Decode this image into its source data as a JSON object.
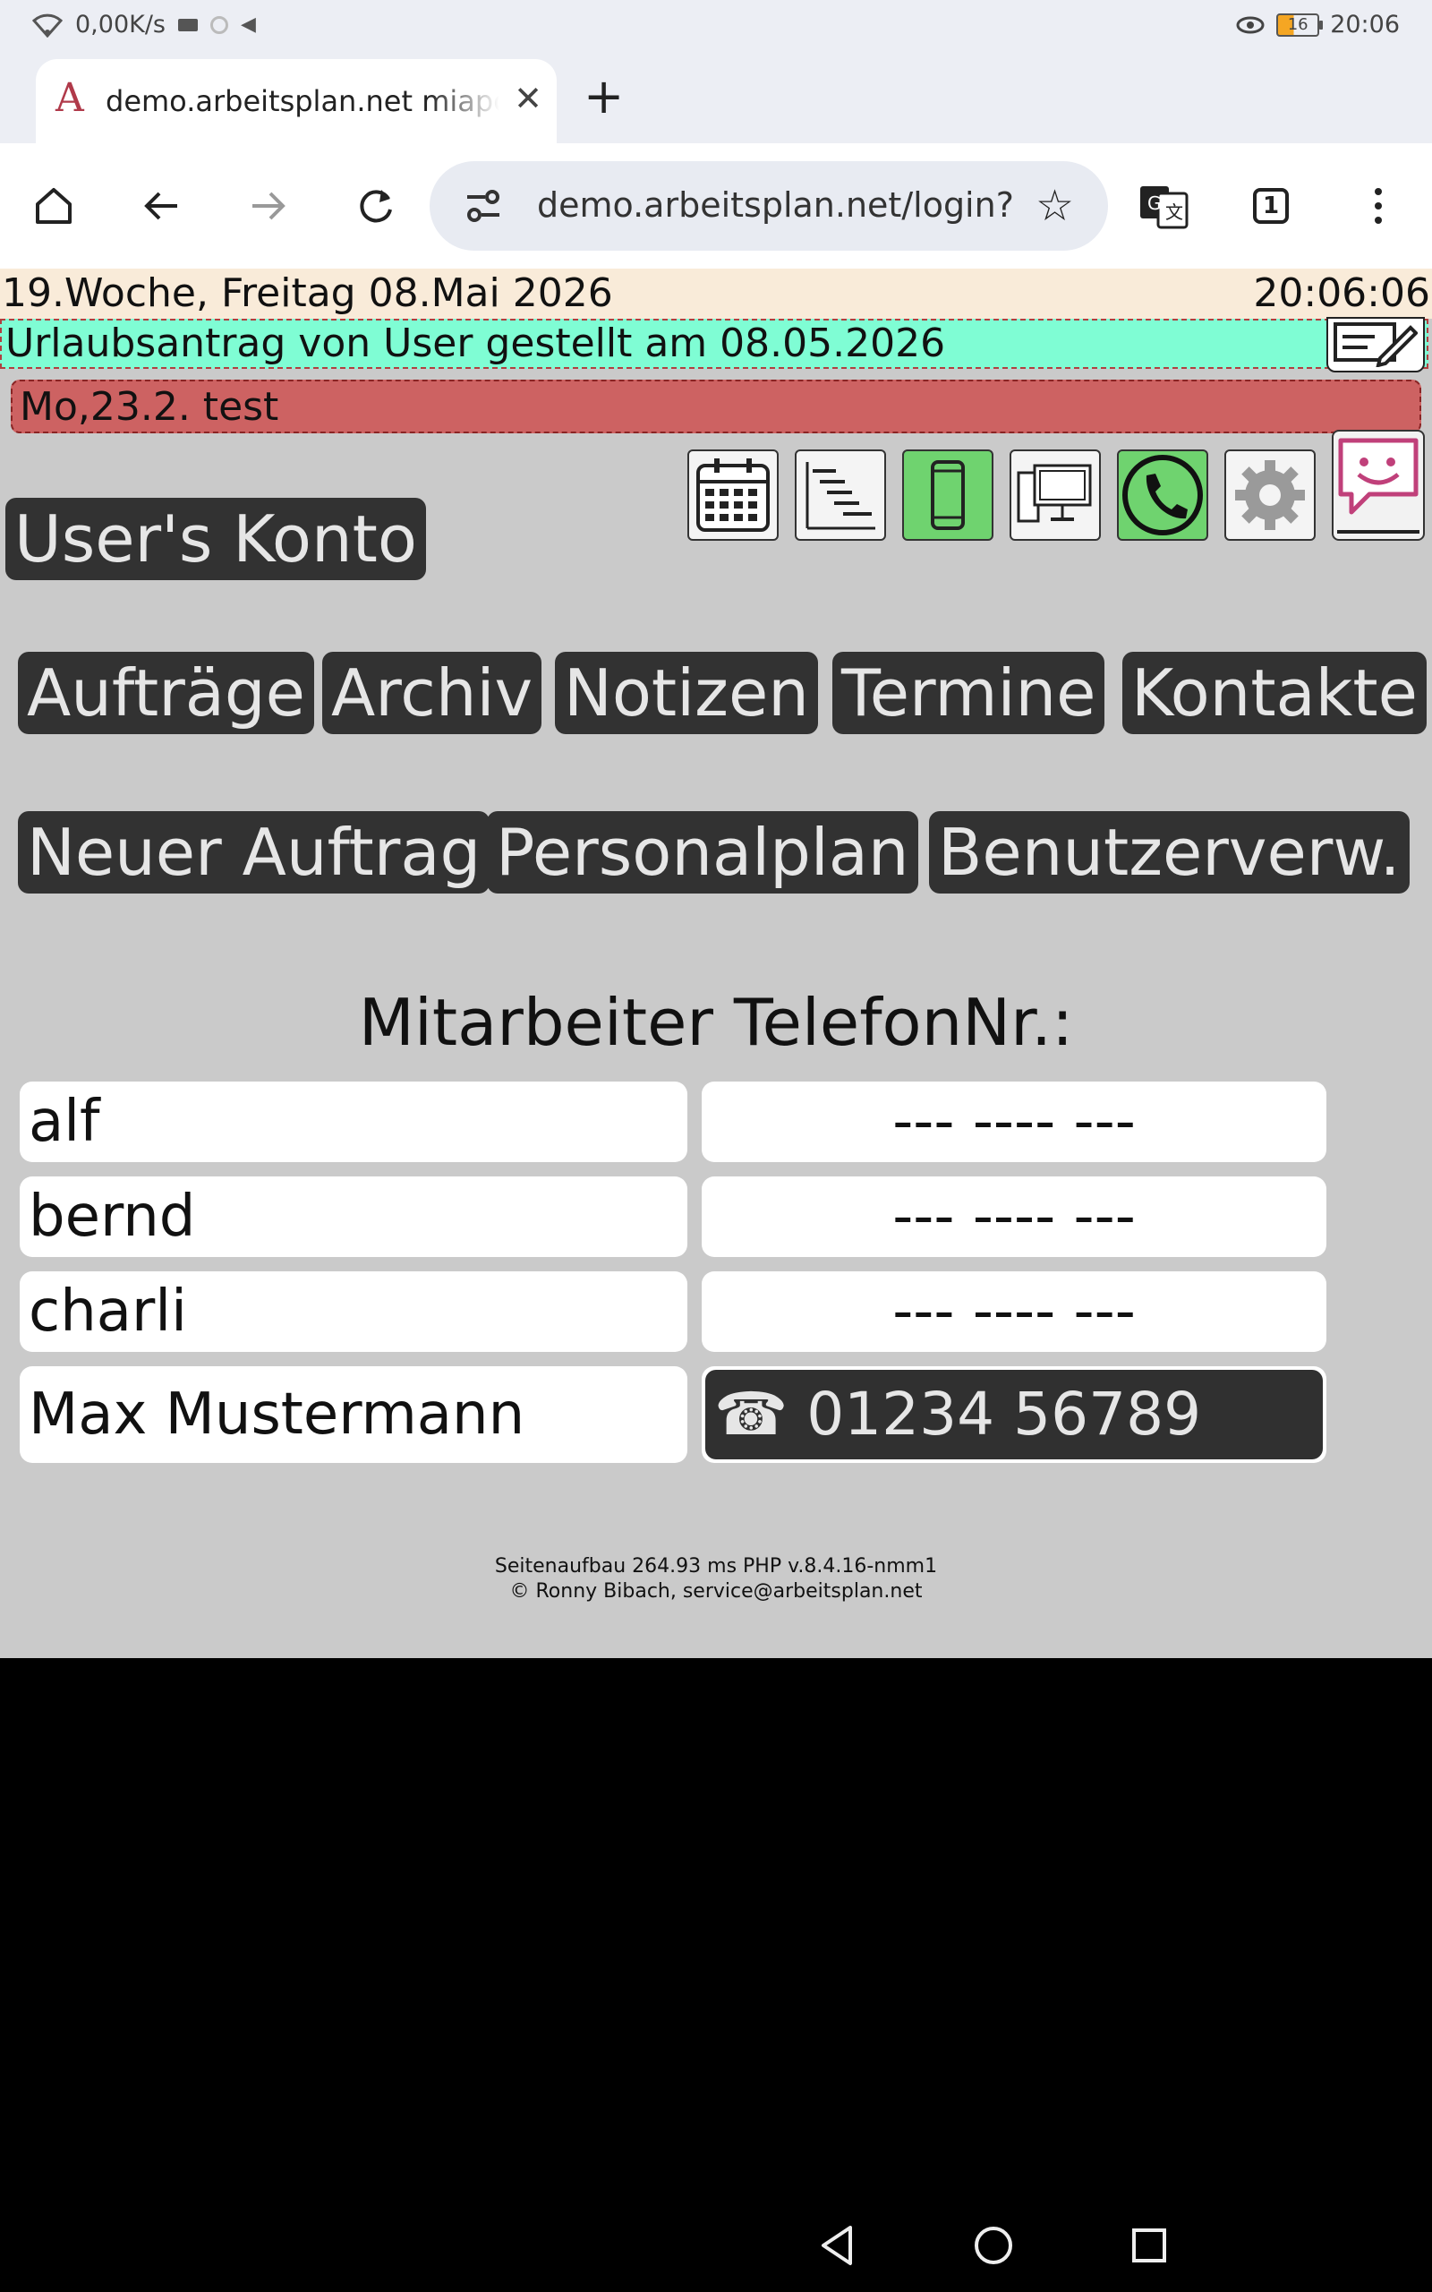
{
  "status_bar": {
    "net_speed": "0,00K/s",
    "battery_level": "16",
    "time": "20:06",
    "icons": [
      "wifi-icon",
      "keyboard-icon",
      "sync-icon",
      "volume-icon",
      "eye-icon",
      "battery-icon"
    ]
  },
  "browser": {
    "tab_title": "demo.arbeitsplan.net miapc",
    "url": "demo.arbeitsplan.net/login?",
    "tab_count": "1"
  },
  "date_bar": {
    "date": "19.Woche, Freitag 08.Mai 2026",
    "time": "20:06:06"
  },
  "notice": "Urlaubsantrag von User gestellt am 08.05.2026",
  "alert": "Mo,23.2. test",
  "account_button": "User's Konto",
  "nav_row1": [
    "Aufträge",
    "Archiv",
    "Notizen",
    "Termine",
    "Kontakte"
  ],
  "nav_row2": [
    "Neuer Auftrag",
    "Personalplan",
    "Benutzerverw."
  ],
  "phone_heading": "Mitarbeiter TelefonNr.:",
  "employees": [
    {
      "name": "alf",
      "phone": "--- ---- ---"
    },
    {
      "name": "bernd",
      "phone": "--- ---- ---"
    },
    {
      "name": "charli",
      "phone": "--- ---- ---"
    },
    {
      "name": "Max Mustermann",
      "phone": "☎ 01234 56789"
    }
  ],
  "footer": {
    "line1": "Seitenaufbau 264.93 ms PHP v.8.4.16-nmm1",
    "line2": "© Ronny Bibach, service@arbeitsplan.net"
  },
  "colors": {
    "page_bg": "#cacaca",
    "date_bar": "#f9ebd9",
    "notice": "#7ffdd4",
    "alert": "#cd6262",
    "button": "#323232",
    "button_text": "#e6e6e6",
    "green_icon": "#6fd36f"
  }
}
